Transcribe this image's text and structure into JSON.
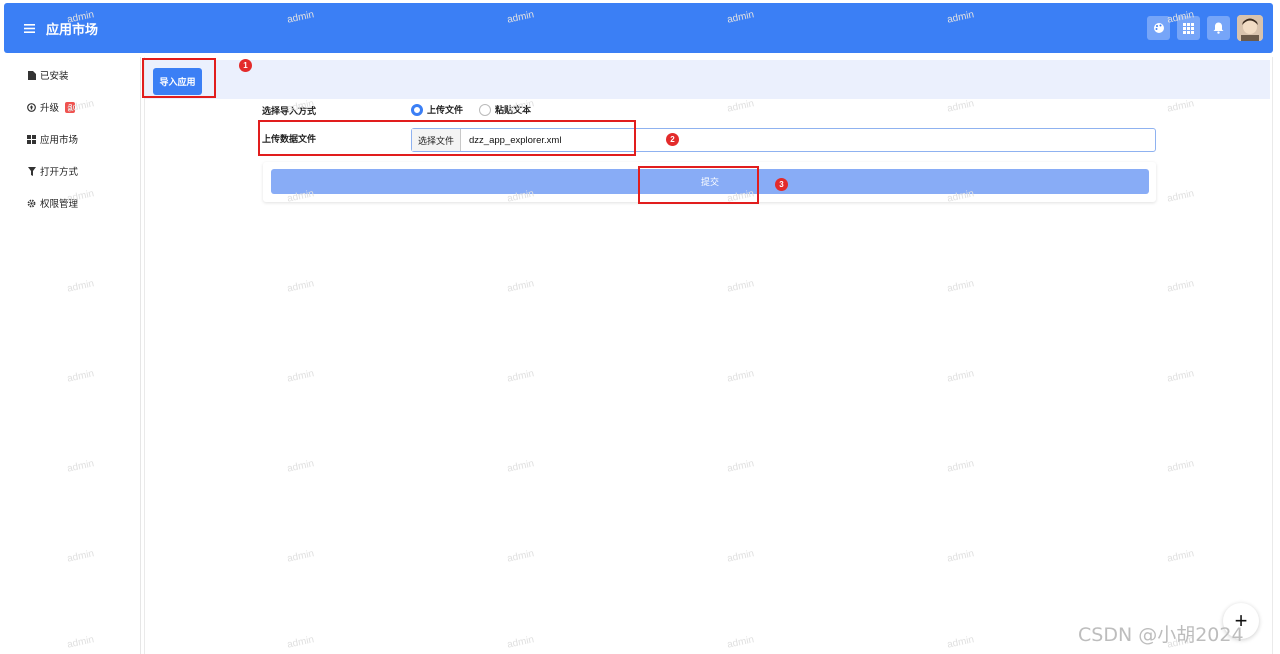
{
  "header": {
    "title": "应用市场",
    "menu_icon": "hamburger-icon",
    "icons": [
      "palette-icon",
      "apps-grid-icon",
      "bell-icon"
    ],
    "accent_color": "#3b7ff5"
  },
  "sidebar": {
    "items": [
      {
        "label": "已安装",
        "icon": "file-icon"
      },
      {
        "label": "升级",
        "icon": "upload-circle-icon",
        "badge": "3"
      },
      {
        "label": "应用市场",
        "icon": "grid-icon"
      },
      {
        "label": "打开方式",
        "icon": "filter-icon"
      },
      {
        "label": "权限管理",
        "icon": "gear-icon"
      }
    ]
  },
  "toolbar": {
    "import_label": "导入应用"
  },
  "form": {
    "method_label": "选择导入方式",
    "method_options": [
      {
        "label": "上传文件",
        "checked": true
      },
      {
        "label": "粘贴文本",
        "checked": false
      }
    ],
    "file_label": "上传数据文件",
    "file_choose_label": "选择文件",
    "file_name": "dzz_app_explorer.xml",
    "submit_label": "提交"
  },
  "annotations": {
    "markers": [
      "1",
      "2",
      "3"
    ],
    "color": "#e11d1d"
  },
  "watermark": "admin",
  "floating_button": "+",
  "footer_watermark": "CSDN @小胡2024"
}
